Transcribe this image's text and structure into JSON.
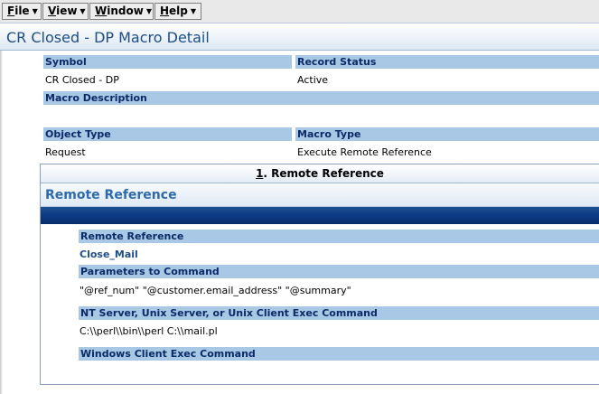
{
  "menu": {
    "file": {
      "mnemonic": "F",
      "rest": "ile"
    },
    "view": {
      "mnemonic": "V",
      "rest": "iew"
    },
    "window": {
      "mnemonic": "W",
      "rest": "indow"
    },
    "help": {
      "mnemonic": "H",
      "rest": "elp"
    },
    "arrow_glyph": "▼"
  },
  "page": {
    "title": "CR Closed - DP Macro Detail"
  },
  "fields": {
    "symbol": {
      "label": "Symbol",
      "value": "CR Closed - DP"
    },
    "record_status": {
      "label": "Record Status",
      "value": "Active"
    },
    "macro_description": {
      "label": "Macro Description",
      "value": ""
    },
    "object_type": {
      "label": "Object Type",
      "value": "Request"
    },
    "macro_type": {
      "label": "Macro Type",
      "value": "Execute Remote Reference"
    }
  },
  "section": {
    "tab_number": "1",
    "tab_label": ". Remote Reference",
    "title": "Remote Reference",
    "remote_reference": {
      "label": "Remote Reference",
      "value": "Close_Mail"
    },
    "parameters": {
      "label": "Parameters to Command",
      "value": "\"@ref_num\" \"@customer.email_address\" \"@summary\""
    },
    "nt_command": {
      "label": "NT Server, Unix Server, or Unix Client Exec Command",
      "value": "C:\\\\perl\\\\bin\\\\perl C:\\\\mail.pl"
    },
    "windows_command": {
      "label": "Windows Client Exec Command",
      "value": ""
    }
  },
  "colors": {
    "label_bg": "#a9c8e6",
    "label_text": "#0b2a66",
    "title_text": "#1d4d8a",
    "blue_bar": "#0d3c86"
  }
}
